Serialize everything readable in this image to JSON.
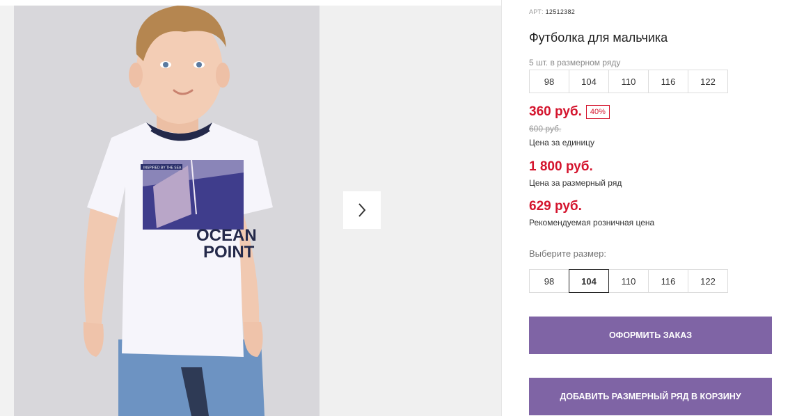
{
  "product": {
    "sku_label": "АРТ:",
    "sku_value": "12512382",
    "title": "Футболка для мальчика",
    "pack_note": "5 шт. в размерном ряду",
    "pack_sizes": [
      "98",
      "104",
      "110",
      "116",
      "122"
    ],
    "unit_price": "360 руб.",
    "discount_badge": "40%",
    "old_price": "600 руб.",
    "unit_price_note": "Цена за единицу",
    "pack_price": "1 800 руб.",
    "pack_price_note": "Цена за размерный ряд",
    "retail_price": "629 руб.",
    "retail_price_note": "Рекомендуемая розничная цена",
    "choose_size_label": "Выберите размер:",
    "sizes": [
      "98",
      "104",
      "110",
      "116",
      "122"
    ],
    "selected_size": "104"
  },
  "buttons": {
    "order": "Оформить заказ",
    "add_pack_to_cart": "Добавить размерный ряд в корзину"
  },
  "gallery": {
    "next_icon": "chevron-right-icon",
    "tshirt_print": {
      "banner_text": "INSPIRED BY THE SEA",
      "line1": "OCEAN",
      "line2": "POINT"
    }
  },
  "colors": {
    "price_red": "#d4142d",
    "button_purple": "#7f64a5"
  }
}
